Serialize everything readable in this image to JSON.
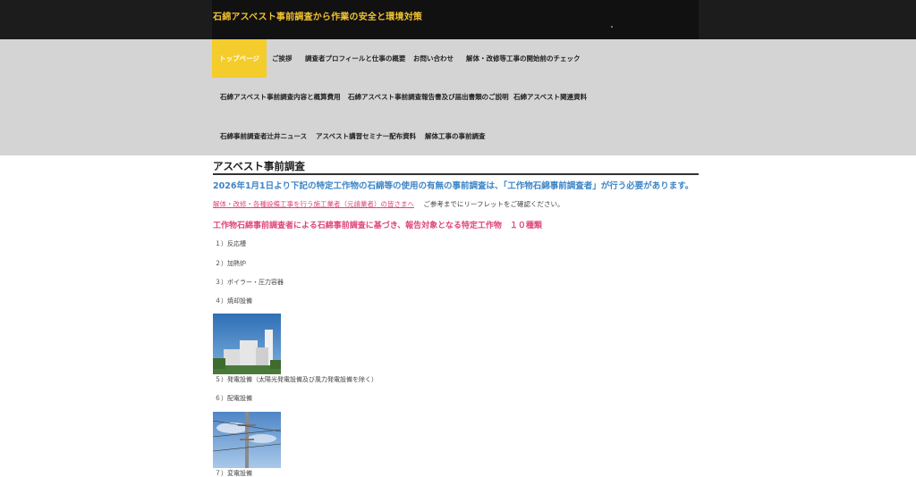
{
  "header": {
    "site_title": "石綿アスベスト事前調査から作業の安全と環境対策"
  },
  "nav": {
    "row1": [
      "トップページ",
      "ご挨拶",
      "調査者プロフィールと仕事の概要",
      "お問い合わせ",
      "解体・改修等工事の開始前のチェック"
    ],
    "row2": [
      "石綿アスベスト事前調査内容と概算費用",
      "石綿アスベスト事前調査報告書及び届出書類のご説明",
      "石綿アスベスト関連資料"
    ],
    "row3": [
      "石綿事前調査者辻井ニュース",
      "アスベスト講習セミナー配布資料",
      "解体工事の事前調査"
    ]
  },
  "content": {
    "heading": "アスベスト事前調査",
    "lead": "2026年1月1日より下記の特定工作物の石綿等の使用の有無の事前調査は、「工作物石綿事前調査者」が行う必要があります。",
    "notice_link": "解体・改修・各種設備工事を行う施工業者（元請業者）の皆さまへ",
    "notice_rest": "ご参考までにリーフレットをご確認ください。",
    "pink_heading": "工作物石綿事前調査者による石綿事前調査に基づき、報告対象となる特定工作物　１０種類",
    "items": [
      "１）反応槽",
      "２）加熱炉",
      "３）ボイラー・圧力容器",
      "４）焼却設備",
      "５）発電設備（太陽光発電設備及び風力発電設備を除く）",
      "６）配電設備",
      "７）変電設備"
    ]
  },
  "colors": {
    "accent_yellow": "#f4cc2c",
    "title_gold": "#f1c232",
    "lead_blue": "#3d85c6",
    "pink": "#e0457b"
  }
}
